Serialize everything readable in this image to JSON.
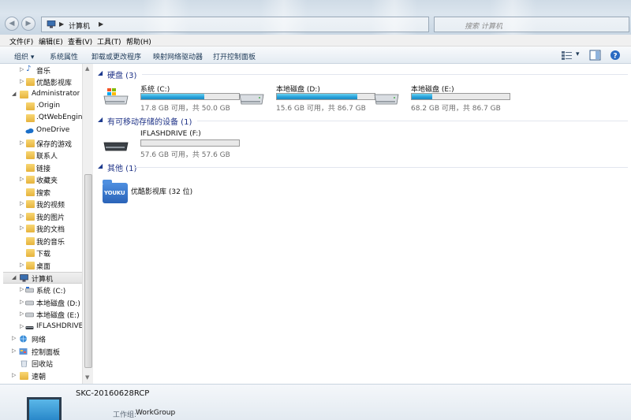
{
  "address": {
    "crumb": "计算机"
  },
  "search": {
    "placeholder": "搜索 计算机"
  },
  "menu": [
    "文件(F)",
    "编辑(E)",
    "查看(V)",
    "工具(T)",
    "帮助(H)"
  ],
  "toolbar": {
    "organize": "组织 ▾",
    "system_props": "系统属性",
    "uninstall": "卸载或更改程序",
    "map_drive": "映射网络驱动器",
    "control_panel": "打开控制面板"
  },
  "sidebar": {
    "items": [
      {
        "label": "音乐",
        "icon": "music-icon"
      },
      {
        "label": "优酷影视库",
        "icon": "folder-icon"
      },
      {
        "label": "Administrator",
        "icon": "user-folder-icon"
      },
      {
        "label": ".Origin",
        "icon": "folder-icon"
      },
      {
        "label": ".QtWebEngine",
        "icon": "folder-icon"
      },
      {
        "label": "OneDrive",
        "icon": "cloud-icon"
      },
      {
        "label": "保存的游戏",
        "icon": "folder-icon"
      },
      {
        "label": "联系人",
        "icon": "folder-icon"
      },
      {
        "label": "链接",
        "icon": "folder-icon"
      },
      {
        "label": "收藏夹",
        "icon": "folder-icon"
      },
      {
        "label": "搜索",
        "icon": "folder-icon"
      },
      {
        "label": "我的视频",
        "icon": "folder-icon"
      },
      {
        "label": "我的图片",
        "icon": "folder-icon"
      },
      {
        "label": "我的文档",
        "icon": "folder-icon"
      },
      {
        "label": "我的音乐",
        "icon": "folder-icon"
      },
      {
        "label": "下载",
        "icon": "folder-icon"
      },
      {
        "label": "桌面",
        "icon": "folder-icon"
      },
      {
        "label": "计算机",
        "icon": "computer-icon"
      },
      {
        "label": "系统 (C:)",
        "icon": "drive-icon"
      },
      {
        "label": "本地磁盘 (D:)",
        "icon": "drive-icon"
      },
      {
        "label": "本地磁盘 (E:)",
        "icon": "drive-icon"
      },
      {
        "label": "IFLASHDRIVE (F:)",
        "icon": "usb-drive-icon"
      },
      {
        "label": "网络",
        "icon": "network-icon"
      },
      {
        "label": "控制面板",
        "icon": "control-panel-icon"
      },
      {
        "label": "回收站",
        "icon": "recycle-bin-icon"
      },
      {
        "label": "速朝",
        "icon": "folder-icon"
      }
    ]
  },
  "groups": {
    "hdd": "硬盘 (3)",
    "removable": "有可移动存储的设备 (1)",
    "other": "其他 (1)"
  },
  "drives": [
    {
      "name": "系统 (C:)",
      "free": "17.8 GB 可用，共 50.0 GB",
      "used_fraction": 0.644
    },
    {
      "name": "本地磁盘 (D:)",
      "free": "15.6 GB 可用，共 86.7 GB",
      "used_fraction": 0.82
    },
    {
      "name": "本地磁盘 (E:)",
      "free": "68.2 GB 可用，共 86.7 GB",
      "used_fraction": 0.213
    }
  ],
  "removable": {
    "name": "IFLASHDRIVE (F:)",
    "free": "57.6 GB 可用，共 57.6 GB",
    "used_fraction": 0.0
  },
  "other_item": {
    "name": "优酷影视库 (32 位)",
    "logo_text": "YOUKU"
  },
  "details": {
    "pc_name": "SKC-20160628RCP",
    "workgroup_label": "工作组:",
    "workgroup_value": "WorkGroup"
  },
  "colors": {
    "accent": "#1e3287",
    "bar_fill": "#26a0da"
  }
}
